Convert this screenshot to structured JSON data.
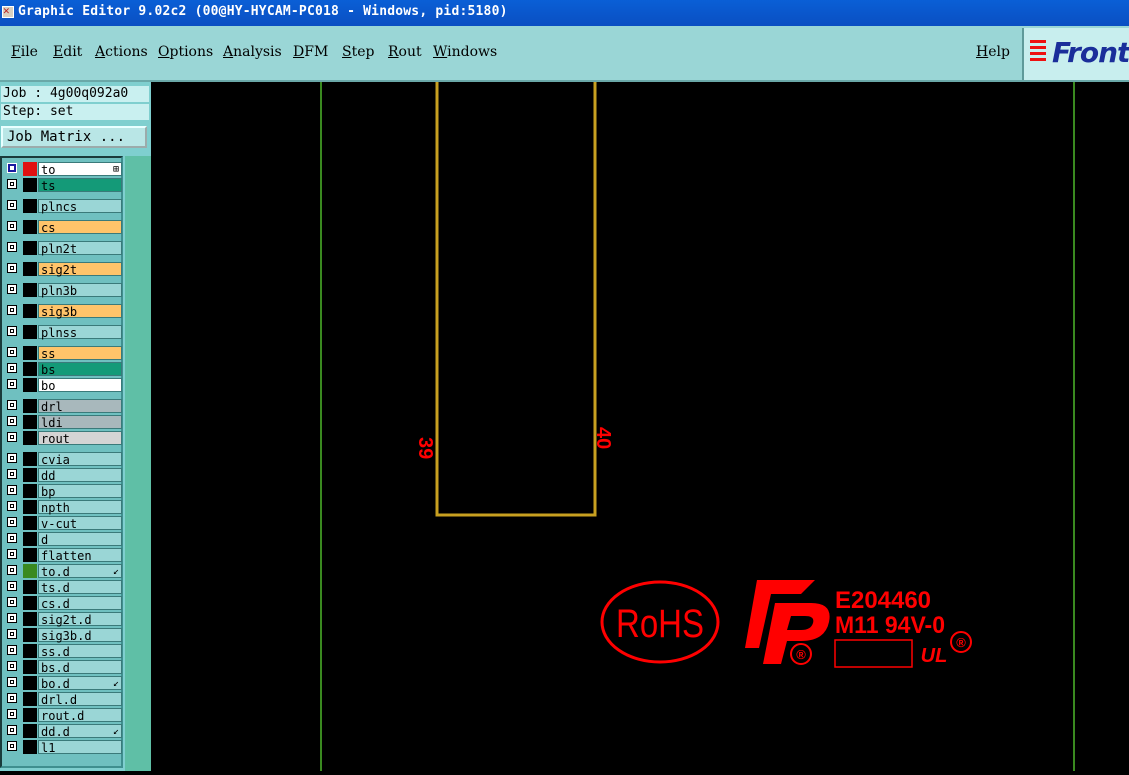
{
  "window": {
    "title": "Graphic Editor 9.02c2 (00@HY-HYCAM-PC018 - Windows, pid:5180)"
  },
  "menu": {
    "items": [
      "File",
      "Edit",
      "Actions",
      "Options",
      "Analysis",
      "DFM",
      "Step",
      "Rout",
      "Windows"
    ],
    "help": "Help"
  },
  "logo": {
    "text": "Front"
  },
  "job": {
    "label": "Job : 4g00q092a0",
    "step": "Step: set"
  },
  "job_matrix_button": "Job Matrix ...",
  "layers": [
    {
      "name": "to",
      "color": "#ffffff",
      "checked": true,
      "swatch": "#e11111",
      "flag": "⊞"
    },
    {
      "name": "ts",
      "color": "#149a78",
      "checked": false
    },
    {
      "name": "plncs",
      "color": "#9ad6d6",
      "checked": false
    },
    {
      "name": "cs",
      "color": "#ffc46a",
      "checked": false
    },
    {
      "name": "pln2t",
      "color": "#9ad6d6",
      "checked": false
    },
    {
      "name": "sig2t",
      "color": "#ffc46a",
      "checked": false
    },
    {
      "name": "pln3b",
      "color": "#9ad6d6",
      "checked": false
    },
    {
      "name": "sig3b",
      "color": "#ffc46a",
      "checked": false
    },
    {
      "name": "plnss",
      "color": "#9ad6d6",
      "checked": false
    },
    {
      "name": "ss",
      "color": "#ffc46a",
      "checked": false
    },
    {
      "name": "bs",
      "color": "#149a78",
      "checked": false
    },
    {
      "name": "bo",
      "color": "#ffffff",
      "checked": false
    },
    {
      "name": "drl",
      "color": "#a8b8bc",
      "checked": false
    },
    {
      "name": "ldi",
      "color": "#a8b8bc",
      "checked": false
    },
    {
      "name": "rout",
      "color": "#d4d4d4",
      "checked": false
    },
    {
      "name": "cvia",
      "color": "#9ad6d6",
      "checked": false
    },
    {
      "name": "dd",
      "color": "#9ad6d6",
      "checked": false
    },
    {
      "name": "bp",
      "color": "#9ad6d6",
      "checked": false
    },
    {
      "name": "npth",
      "color": "#9ad6d6",
      "checked": false
    },
    {
      "name": "v-cut",
      "color": "#9ad6d6",
      "checked": false
    },
    {
      "name": "d",
      "color": "#9ad6d6",
      "checked": false
    },
    {
      "name": "flatten",
      "color": "#9ad6d6",
      "checked": false
    },
    {
      "name": "to.d",
      "color": "#9ad6d6",
      "checked": false,
      "swatch": "#3a8a20",
      "flag": "↙"
    },
    {
      "name": "ts.d",
      "color": "#9ad6d6",
      "checked": false
    },
    {
      "name": "cs.d",
      "color": "#9ad6d6",
      "checked": false
    },
    {
      "name": "sig2t.d",
      "color": "#9ad6d6",
      "checked": false
    },
    {
      "name": "sig3b.d",
      "color": "#9ad6d6",
      "checked": false
    },
    {
      "name": "ss.d",
      "color": "#9ad6d6",
      "checked": false
    },
    {
      "name": "bs.d",
      "color": "#9ad6d6",
      "checked": false
    },
    {
      "name": "bo.d",
      "color": "#9ad6d6",
      "checked": false,
      "flag": "↙"
    },
    {
      "name": "drl.d",
      "color": "#9ad6d6",
      "checked": false
    },
    {
      "name": "rout.d",
      "color": "#9ad6d6",
      "checked": false
    },
    {
      "name": "dd.d",
      "color": "#9ad6d6",
      "checked": false,
      "flag": "↙"
    },
    {
      "name": "l1",
      "color": "#9ad6d6",
      "checked": false
    }
  ],
  "canvas": {
    "background": "#000000",
    "label_left": "39",
    "label_right": "40",
    "rohs": "RoHS",
    "cert_code": "E204460",
    "cert_grade": "M11 94V-0",
    "registered": "®",
    "ul_mark": "UL",
    "colors": {
      "board_edge": "#3a8a20",
      "outline": "#c8a020",
      "marking": "#ff0000"
    }
  }
}
